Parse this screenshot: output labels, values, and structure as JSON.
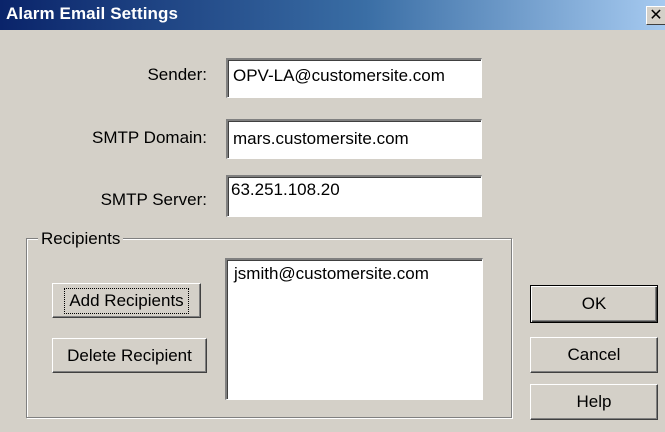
{
  "window": {
    "title": "Alarm Email Settings",
    "close_glyph": "✕"
  },
  "fields": {
    "sender_label": "Sender:",
    "sender_value": "OPV-LA@customersite.com",
    "smtp_domain_label": "SMTP Domain:",
    "smtp_domain_value": "mars.customersite.com",
    "smtp_server_label": "SMTP Server:",
    "smtp_server_value": "63.251.108.20"
  },
  "recipients": {
    "group_label": "Recipients",
    "add_button": "Add Recipients",
    "delete_button": "Delete Recipient",
    "items": [
      "jsmith@customersite.com"
    ]
  },
  "buttons": {
    "ok": "OK",
    "cancel": "Cancel",
    "help": "Help"
  },
  "colors": {
    "titlebar_start": "#0a246a",
    "titlebar_end": "#a6caf0",
    "dialog_bg": "#d4d0c8"
  }
}
